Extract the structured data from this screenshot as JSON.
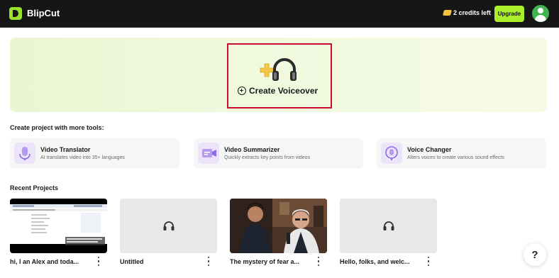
{
  "app": {
    "name": "BlipCut",
    "credits": "2 credits left",
    "upgrade_label": "Upgrade"
  },
  "hero": {
    "label": "Create Voiceover"
  },
  "tools": {
    "heading": "Create project with more tools:",
    "items": [
      {
        "name": "Video Translator",
        "desc": "AI translates video into 35+ languages",
        "icon": "microphone-icon"
      },
      {
        "name": "Video Summarizer",
        "desc": "Quickly extracts key points from videos",
        "icon": "video-summary-icon"
      },
      {
        "name": "Voice Changer",
        "desc": "Alters voices to create various sound effects",
        "icon": "voice-changer-icon"
      }
    ]
  },
  "recent": {
    "heading": "Recent Projects",
    "items": [
      {
        "title": "hi, I an Alex and toda...",
        "thumb": "screen-recording"
      },
      {
        "title": "Untitled",
        "thumb": "headphones-icon"
      },
      {
        "title": "The mystery of fear a...",
        "thumb": "podcast-photo"
      },
      {
        "title": "Hello, folks, and welc...",
        "thumb": "headphones-icon"
      }
    ]
  },
  "colors": {
    "accent": "#a9f02b",
    "topbar": "#161616",
    "highlight_box": "#c8102e"
  },
  "help_label": "?"
}
